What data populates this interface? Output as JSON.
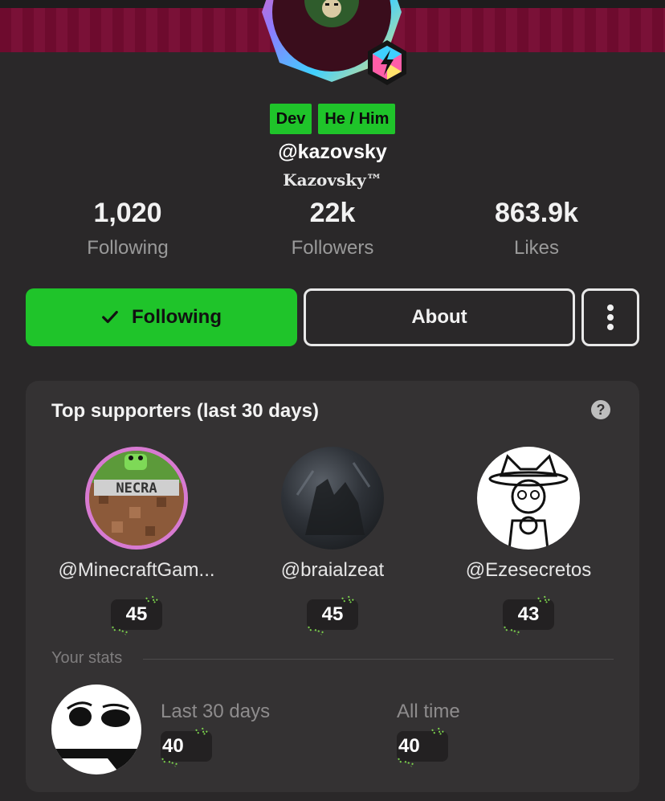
{
  "profile": {
    "tags": [
      "Dev",
      "He / Him"
    ],
    "handle": "@kazovsky",
    "display_name": "Kazovsky™",
    "stats": [
      {
        "value": "1,020",
        "label": "Following"
      },
      {
        "value": "22k",
        "label": "Followers"
      },
      {
        "value": "863.9k",
        "label": "Likes"
      }
    ]
  },
  "actions": {
    "following_label": "Following",
    "about_label": "About",
    "more_icon": "more-vertical-icon"
  },
  "supporters": {
    "title": "Top supporters (last 30 days)",
    "help_icon": "?",
    "items": [
      {
        "name": "@MinecraftGam...",
        "score": "45"
      },
      {
        "name": "@braialzeat",
        "score": "45"
      },
      {
        "name": "@Ezesecretos",
        "score": "43"
      }
    ]
  },
  "your_stats": {
    "label": "Your stats",
    "last30_label": "Last 30 days",
    "last30_value": "40",
    "alltime_label": "All time",
    "alltime_value": "40"
  },
  "colors": {
    "accent": "#1fc42a",
    "background": "#2a2829",
    "card": "#343233",
    "banner": "#7a1137"
  }
}
